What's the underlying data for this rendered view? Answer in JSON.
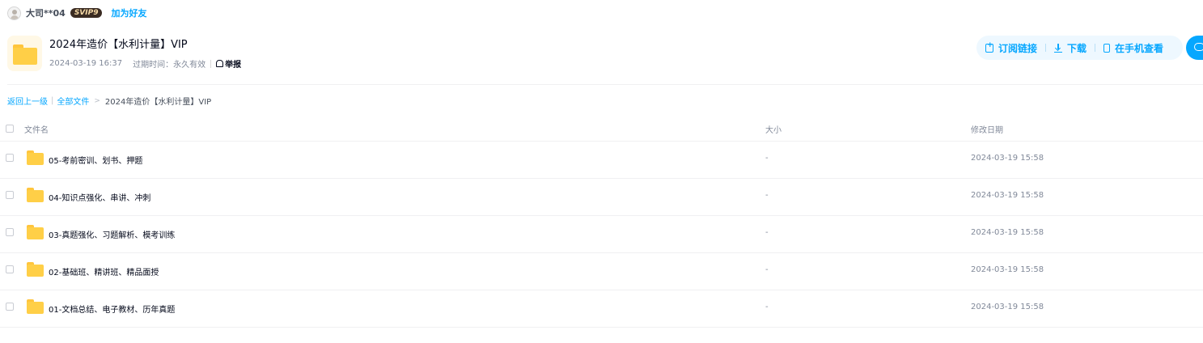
{
  "user": {
    "name": "大司**04",
    "badge": "SVIP9",
    "add_friend": "加为好友"
  },
  "share": {
    "title": "2024年造价【水利计量】VIP",
    "date": "2024-03-19 16:37",
    "expire_label": "过期时间：永久有效",
    "report": "举报"
  },
  "actions": {
    "subscribe": "订阅链接",
    "download": "下载",
    "mobile": "在手机查看"
  },
  "breadcrumb": {
    "back": "返回上一级",
    "all_files": "全部文件",
    "current": "2024年造价【水利计量】VIP"
  },
  "table": {
    "headers": {
      "name": "文件名",
      "size": "大小",
      "modified": "修改日期"
    },
    "rows": [
      {
        "name": "05-考前密训、划书、押题",
        "size": "-",
        "modified": "2024-03-19 15:58"
      },
      {
        "name": "04-知识点强化、串讲、冲刺",
        "size": "-",
        "modified": "2024-03-19 15:58"
      },
      {
        "name": "03-真题强化、习题解析、模考训练",
        "size": "-",
        "modified": "2024-03-19 15:58"
      },
      {
        "name": "02-基础班、精讲班、精品面授",
        "size": "-",
        "modified": "2024-03-19 15:58"
      },
      {
        "name": "01-文档总结、电子教材、历年真题",
        "size": "-",
        "modified": "2024-03-19 15:58"
      }
    ]
  },
  "colors": {
    "accent": "#06a7ff",
    "folder": "#ffcf47",
    "muted_text": "#818999"
  }
}
